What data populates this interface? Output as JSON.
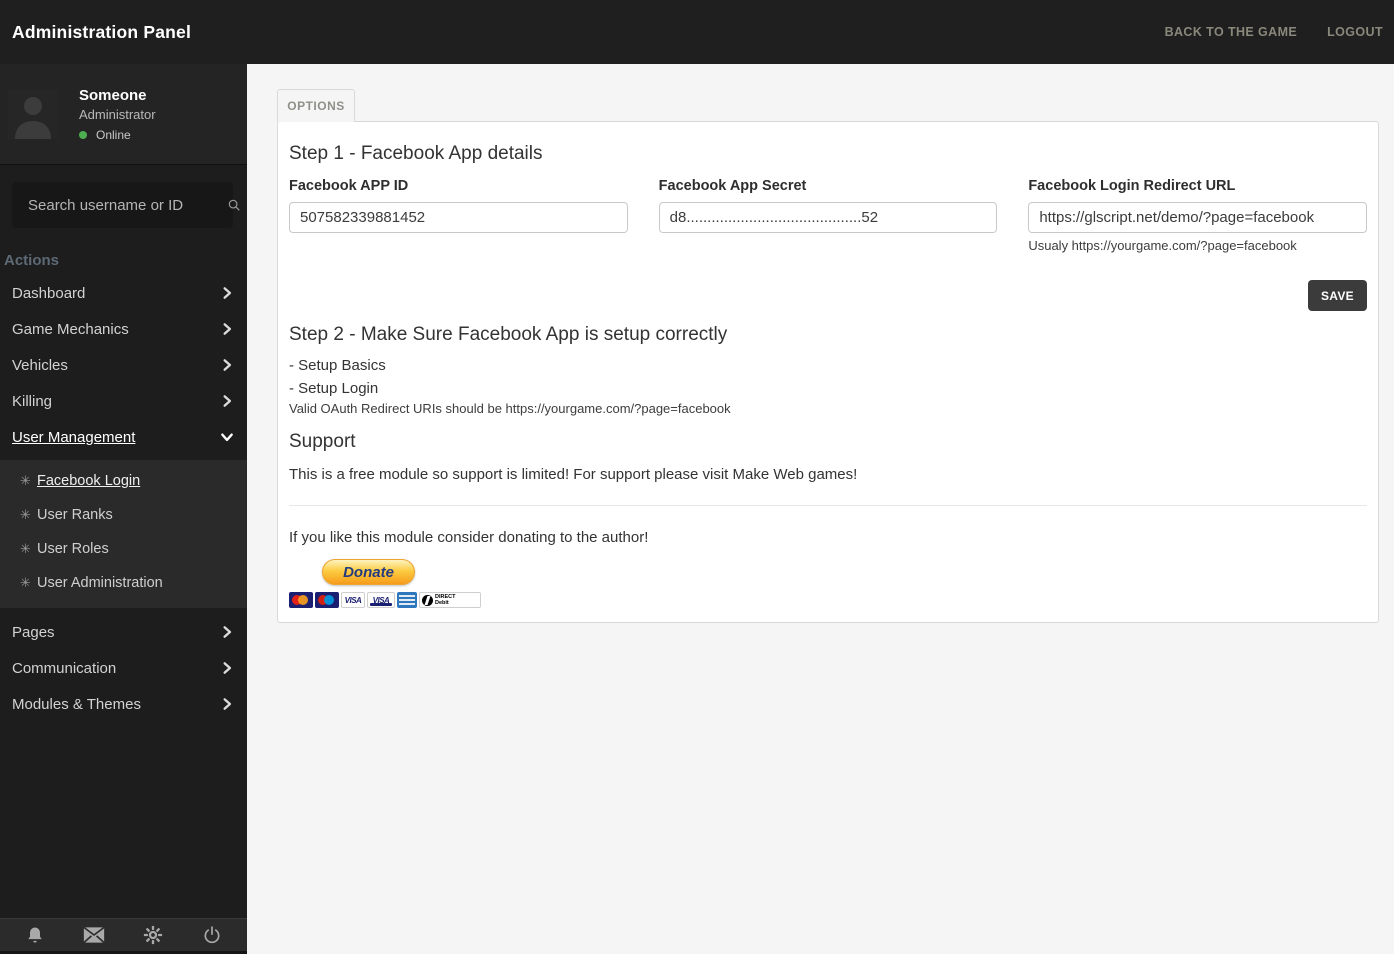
{
  "topbar": {
    "title": "Administration Panel",
    "back_label": "BACK TO THE GAME",
    "logout_label": "LOGOUT"
  },
  "sidebar": {
    "profile": {
      "name": "Someone",
      "role": "Administrator",
      "status": "Online"
    },
    "search": {
      "placeholder": "Search username or ID"
    },
    "section_label": "Actions",
    "nav": [
      {
        "label": "Dashboard"
      },
      {
        "label": "Game Mechanics"
      },
      {
        "label": "Vehicles"
      },
      {
        "label": "Killing"
      },
      {
        "label": "User Management",
        "active": true,
        "expanded": true
      },
      {
        "label": "Pages"
      },
      {
        "label": "Communication"
      },
      {
        "label": "Modules & Themes"
      }
    ],
    "submenu": [
      {
        "label": "Facebook Login",
        "active": true
      },
      {
        "label": "User Ranks"
      },
      {
        "label": "User Roles"
      },
      {
        "label": "User Administration"
      }
    ],
    "submenu_bullet": "✳"
  },
  "main": {
    "tab_label": "OPTIONS",
    "step1": {
      "heading": "Step 1 - Facebook App details",
      "fields": [
        {
          "label": "Facebook APP ID",
          "value": "507582339881452"
        },
        {
          "label": "Facebook App Secret",
          "value": "d8..........................................52"
        },
        {
          "label": "Facebook Login Redirect URL",
          "value": "https://glscript.net/demo/?page=facebook",
          "helper": "Usualy https://yourgame.com/?page=facebook"
        }
      ],
      "save_label": "SAVE"
    },
    "step2": {
      "heading": "Step 2 - Make Sure Facebook App is setup correctly",
      "line1": "- Setup Basics",
      "line2": "- Setup Login",
      "note": "Valid OAuth Redirect URIs should be https://yourgame.com/?page=facebook"
    },
    "support": {
      "heading": "Support",
      "text": "This is a free module so support is limited! For support please visit Make Web games!"
    },
    "donate": {
      "text": "If you like this module consider donating to the author!",
      "button_label": "Donate",
      "visa_label": "VISA",
      "dd_label1": "DIRECT",
      "dd_label2": "Debit"
    }
  },
  "colors": {
    "topbar_bg": "#1f1f1f",
    "sidebar_bg": "#1d1d1d",
    "submenu_bg": "#2a2a2a",
    "online_green": "#4caf50",
    "save_btn_bg": "#3b3b3b",
    "donate_navy": "#253b80",
    "donate_orange": "#f7a521",
    "main_bg": "#f5f5f5"
  }
}
